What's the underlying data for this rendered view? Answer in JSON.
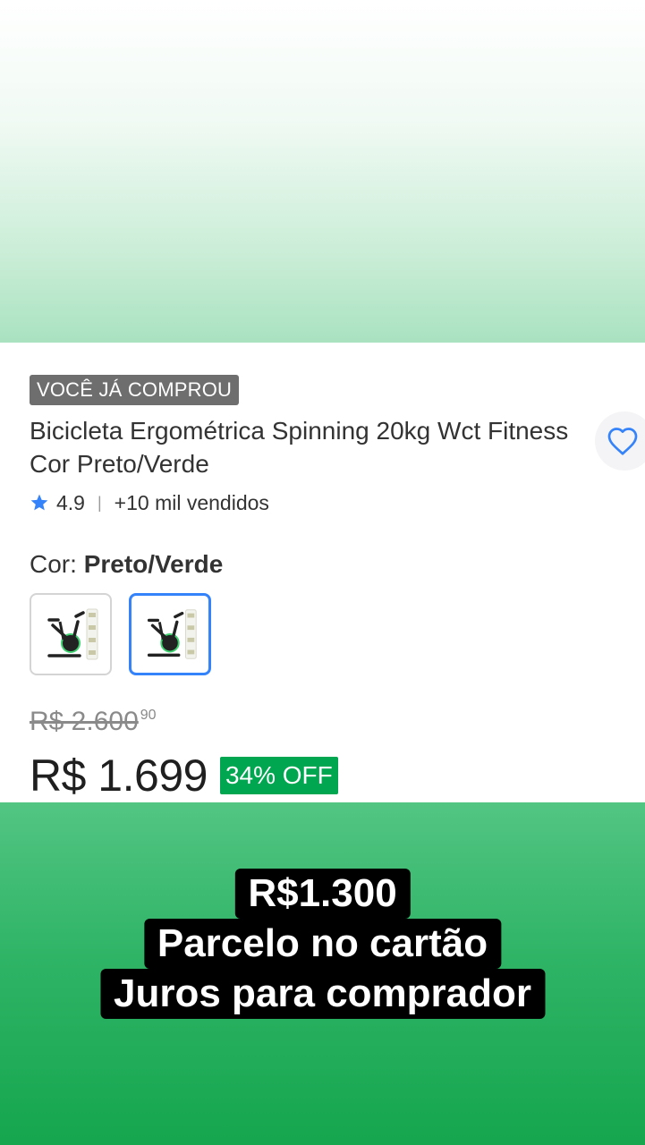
{
  "product": {
    "badge": "VOCÊ JÁ COMPROU",
    "title": "Bicicleta Ergométrica Spinning 20kg Wct Fitness Cor Preto/Verde",
    "rating": "4.9",
    "sold": "+10 mil vendidos",
    "color_label": "Cor:",
    "color_value": "Preto/Verde",
    "old_price": "R$ 2.600",
    "old_price_cents": "90",
    "price": "R$ 1.699",
    "discount": "34% OFF"
  },
  "icons": {
    "favorite": "heart-outline-icon",
    "rating": "star-icon",
    "variant": "exercise-bike-thumbnail"
  },
  "overlay": {
    "line1": "R$1.300",
    "line2": "Parcelo no cartão",
    "line3": "Juros para comprador"
  },
  "colors": {
    "accent_blue": "#3483fa",
    "discount_green": "#00a650",
    "bottom_green": "#15a64e"
  }
}
